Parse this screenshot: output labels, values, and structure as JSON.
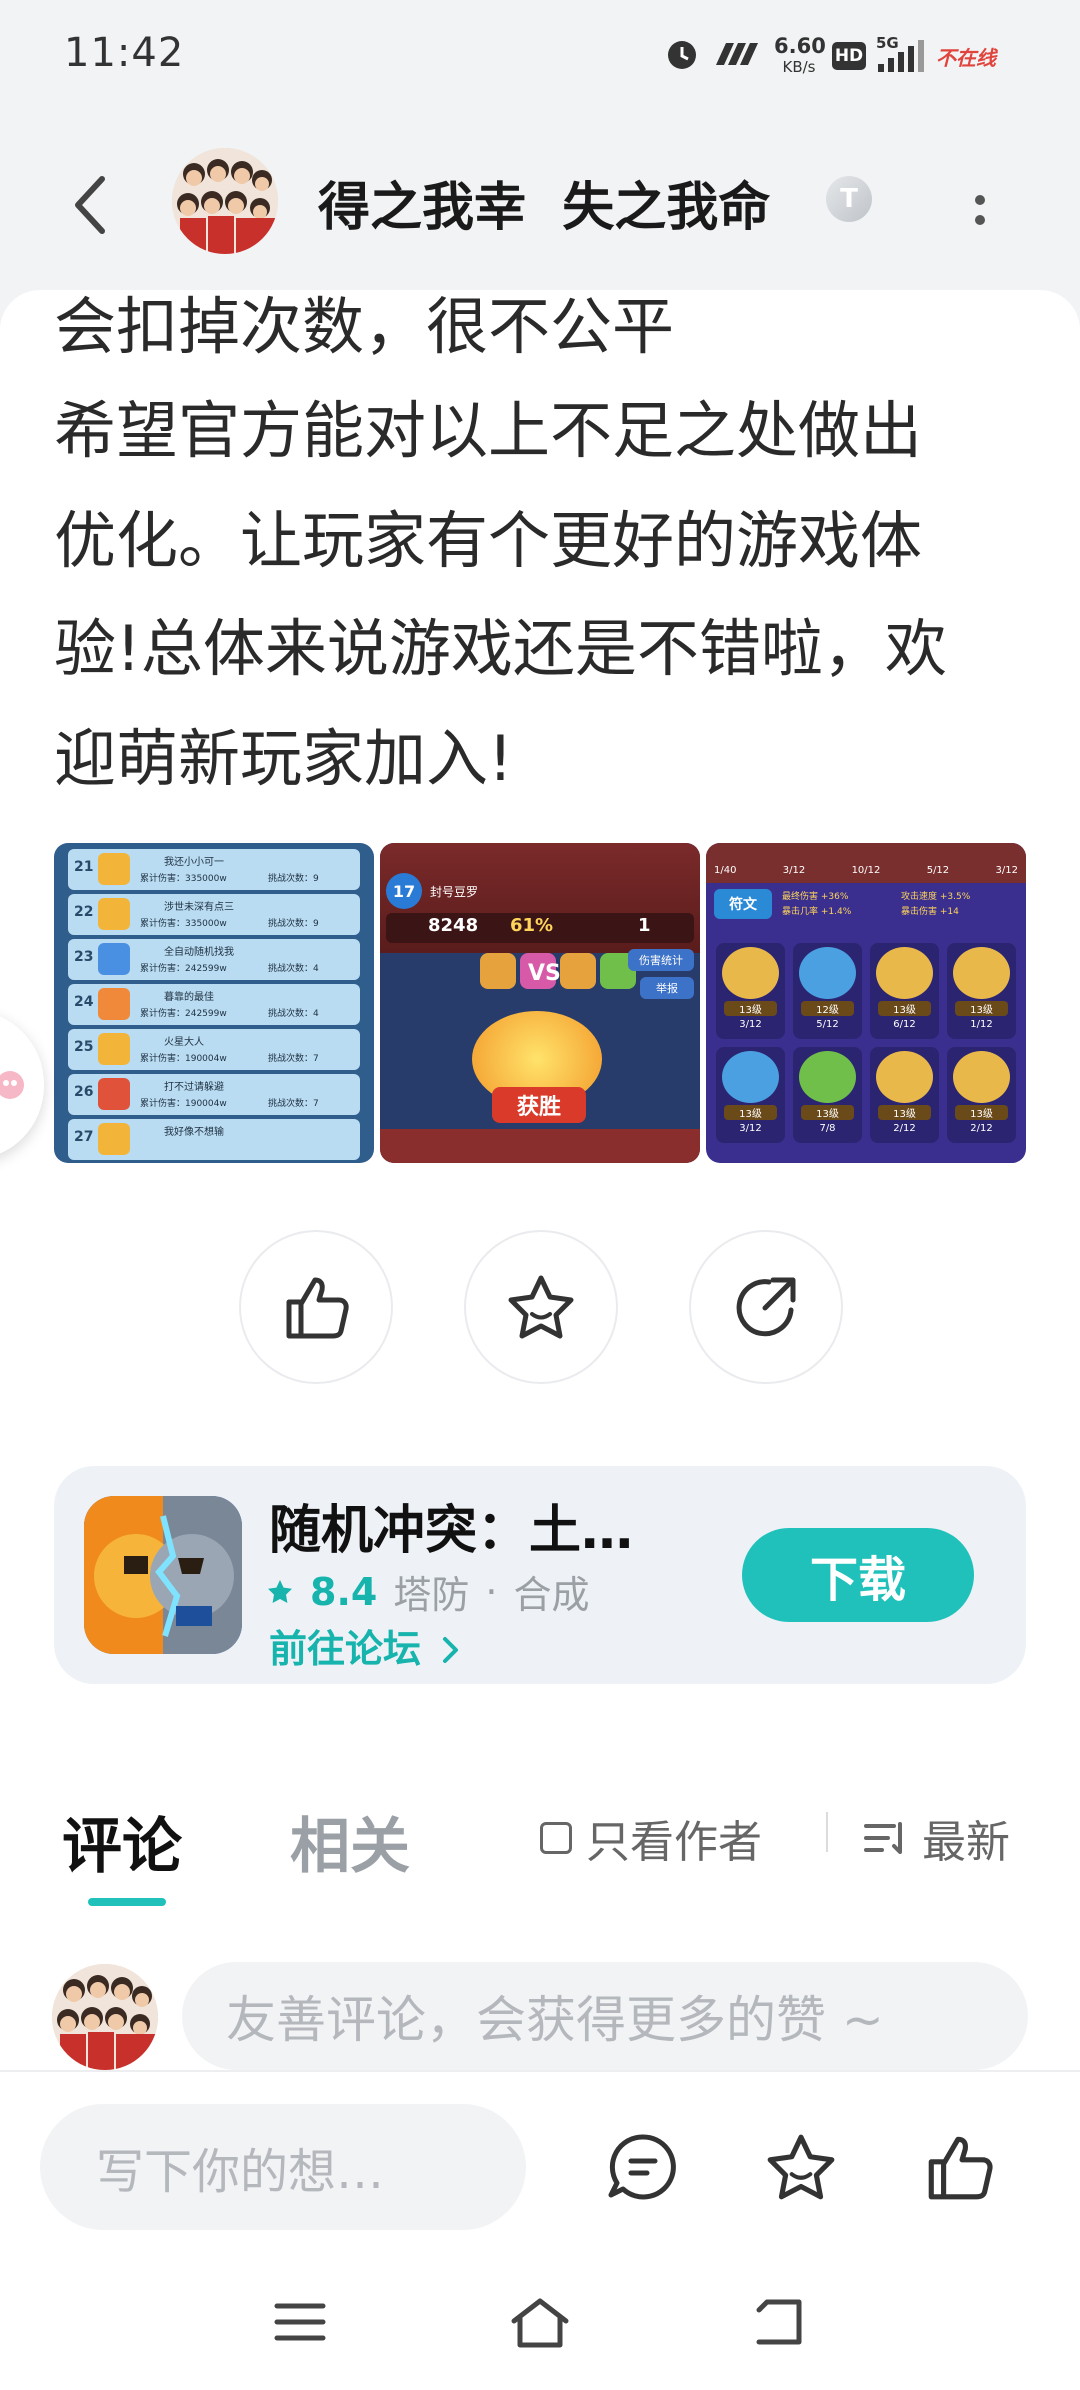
{
  "status_bar": {
    "time": "11:42",
    "net_speed": "6.60",
    "net_unit": "KB/s",
    "hd": "HD",
    "signal": "5G",
    "carrier_badge": "不在线"
  },
  "header": {
    "author_name": "得之我幸  失之我命",
    "verify_badge": "T"
  },
  "post": {
    "lines": [
      "会扣掉次数，很不公平",
      "希望官方能对以上不足之处做出",
      "优化。让玩家有个更好的游戏体",
      "验!总体来说游戏还是不错啦，欢",
      "迎萌新玩家加入!"
    ]
  },
  "screenshots": {
    "shot1": {
      "rows": [
        {
          "rank": "21",
          "name": "我还小小可一",
          "damage": "累计伤害：335000w",
          "count": "挑战次数：9"
        },
        {
          "rank": "22",
          "name": "涉世未深有点三",
          "damage": "累计伤害：335000w",
          "count": "挑战次数：9"
        },
        {
          "rank": "23",
          "name": "全自动随机找我",
          "damage": "累计伤害：242599w",
          "count": "挑战次数：4"
        },
        {
          "rank": "24",
          "name": "暮靠的最佳",
          "damage": "累计伤害：242599w",
          "count": "挑战次数：4"
        },
        {
          "rank": "25",
          "name": "火星大人",
          "damage": "累计伤害：190004w",
          "count": "挑战次数：7"
        },
        {
          "rank": "26",
          "name": "打不过请躲避",
          "damage": "累计伤害：190004w",
          "count": "挑战次数：7"
        },
        {
          "rank": "27",
          "name": "我好像不想输",
          "damage": "",
          "count": ""
        }
      ]
    },
    "shot2": {
      "level": "17",
      "player": "封号豆罗",
      "score": "8248",
      "percent": "61%",
      "count": "1",
      "vs": "VS",
      "result": "获胜",
      "stat_btn": "伤害统计",
      "report_btn": "举报"
    },
    "shot3": {
      "tab": "符文",
      "stats": [
        "最终伤害 +36%",
        "攻击速度 +3.5%",
        "暴击几率 +1.4%",
        "暴击伤害 +14"
      ],
      "top_labels": [
        "1/40",
        "3/12",
        "10/12",
        "5/12",
        "3/12"
      ],
      "grid": [
        {
          "lv": "13级",
          "frac": "3/12"
        },
        {
          "lv": "12级",
          "frac": "5/12"
        },
        {
          "lv": "13级",
          "frac": "6/12"
        },
        {
          "lv": "13级",
          "frac": "1/12"
        },
        {
          "lv": "13级",
          "frac": "3/12"
        },
        {
          "lv": "13级",
          "frac": "7/8"
        },
        {
          "lv": "13级",
          "frac": "2/12"
        },
        {
          "lv": "13级",
          "frac": "2/12"
        }
      ]
    }
  },
  "app_card": {
    "name": "随机冲突：土…",
    "rating": "8.4",
    "tag1": "塔防",
    "dot": "·",
    "tag2": "合成",
    "forum_link": "前往论坛",
    "download": "下载"
  },
  "comments": {
    "tab_comments": "评论",
    "tab_related": "相关",
    "author_only": "只看作者",
    "sort": "最新",
    "prompt": "友善评论，会获得更多的赞 ~"
  },
  "bottom_bar": {
    "input_placeholder": "写下你的想…"
  },
  "colors": {
    "accent": "#20c1bb",
    "accent_text": "#17b3ad"
  }
}
